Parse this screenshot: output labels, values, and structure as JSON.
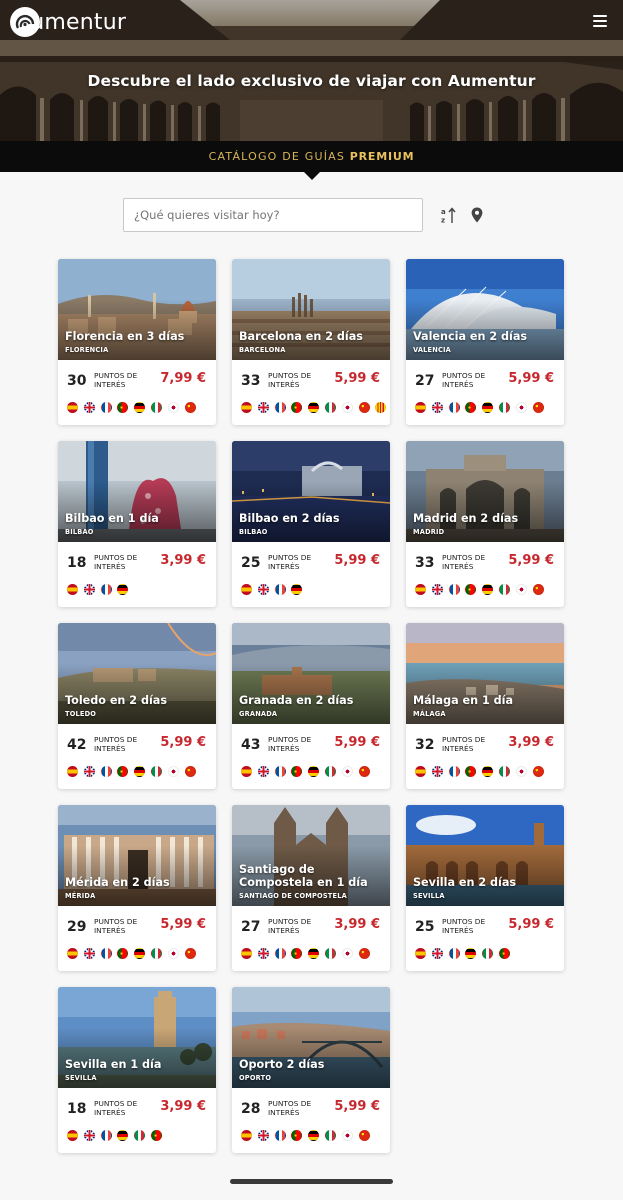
{
  "header": {
    "logo_text": "Aumentur",
    "hero_title": "Descubre el lado exclusivo de viajar con Aumentur",
    "menu_icon": "hamburger-menu-icon"
  },
  "catalog_bar": {
    "label": "CATÁLOGO DE GUÍAS",
    "label_bold": "PREMIUM"
  },
  "search": {
    "placeholder": "¿Qué quieres visitar hoy?",
    "sort_icon": "sort-alpha-icon",
    "location_icon": "location-pin-icon"
  },
  "poi_label": "PUNTOS DE INTERÉS",
  "colors": {
    "price": "#c7282e",
    "catalog_gold": "#d8b45a",
    "catalog_bg": "#0b0b0b"
  },
  "guides": [
    {
      "title": "Florencia en 3 días",
      "city": "FLORENCIA",
      "poi": "30",
      "price": "7,99 €",
      "langs": [
        "es",
        "gb",
        "fr",
        "pt",
        "de",
        "it",
        "jp",
        "cn"
      ],
      "scene": "florence"
    },
    {
      "title": "Barcelona en 2 días",
      "city": "BARCELONA",
      "poi": "33",
      "price": "5,99 €",
      "langs": [
        "es",
        "gb",
        "fr",
        "pt",
        "de",
        "it",
        "jp",
        "cn",
        "ca"
      ],
      "scene": "barcelona"
    },
    {
      "title": "Valencia en 2 días",
      "city": "VALENCIA",
      "poi": "27",
      "price": "5,99 €",
      "langs": [
        "es",
        "gb",
        "fr",
        "pt",
        "de",
        "it",
        "jp",
        "cn"
      ],
      "scene": "valencia"
    },
    {
      "title": "Bilbao en 1 día",
      "city": "BILBAO",
      "poi": "18",
      "price": "3,99 €",
      "langs": [
        "es",
        "gb",
        "fr",
        "de"
      ],
      "scene": "bilbao1"
    },
    {
      "title": "Bilbao en 2 días",
      "city": "BILBAO",
      "poi": "25",
      "price": "5,99 €",
      "langs": [
        "es",
        "gb",
        "fr",
        "de"
      ],
      "scene": "bilbao2"
    },
    {
      "title": "Madrid en 2 días",
      "city": "MADRID",
      "poi": "33",
      "price": "5,99 €",
      "langs": [
        "es",
        "gb",
        "fr",
        "pt",
        "de",
        "it",
        "jp",
        "cn"
      ],
      "scene": "madrid"
    },
    {
      "title": "Toledo en 2 días",
      "city": "TOLEDO",
      "poi": "42",
      "price": "5,99 €",
      "langs": [
        "es",
        "gb",
        "fr",
        "pt",
        "de",
        "it",
        "jp",
        "cn"
      ],
      "scene": "toledo"
    },
    {
      "title": "Granada en 2 días",
      "city": "GRANADA",
      "poi": "43",
      "price": "5,99 €",
      "langs": [
        "es",
        "gb",
        "fr",
        "pt",
        "de",
        "it",
        "jp",
        "cn"
      ],
      "scene": "granada"
    },
    {
      "title": "Málaga en 1 día",
      "city": "MÁLAGA",
      "poi": "32",
      "price": "3,99 €",
      "langs": [
        "es",
        "gb",
        "fr",
        "pt",
        "de",
        "it",
        "jp",
        "cn"
      ],
      "scene": "malaga"
    },
    {
      "title": "Mérida en 2 días",
      "city": "MÉRIDA",
      "poi": "29",
      "price": "5,99 €",
      "langs": [
        "es",
        "gb",
        "fr",
        "pt",
        "de",
        "it",
        "jp",
        "cn"
      ],
      "scene": "merida"
    },
    {
      "title": "Santiago de Compostela en 1 día",
      "city": "SANTIAGO DE COMPOSTELA",
      "poi": "27",
      "price": "3,99 €",
      "langs": [
        "es",
        "gb",
        "fr",
        "pt",
        "de",
        "it",
        "jp",
        "cn"
      ],
      "scene": "santiago"
    },
    {
      "title": "Sevilla en 2 días",
      "city": "SEVILLA",
      "poi": "25",
      "price": "5,99 €",
      "langs": [
        "es",
        "gb",
        "fr",
        "de",
        "it",
        "pt"
      ],
      "scene": "sevilla2"
    },
    {
      "title": "Sevilla en 1 día",
      "city": "SEVILLA",
      "poi": "18",
      "price": "3,99 €",
      "langs": [
        "es",
        "gb",
        "fr",
        "de",
        "it",
        "pt"
      ],
      "scene": "sevilla1"
    },
    {
      "title": "Oporto 2 días",
      "city": "OPORTO",
      "poi": "28",
      "price": "5,99 €",
      "langs": [
        "es",
        "gb",
        "fr",
        "pt",
        "de",
        "it",
        "jp",
        "cn"
      ],
      "scene": "oporto"
    }
  ]
}
